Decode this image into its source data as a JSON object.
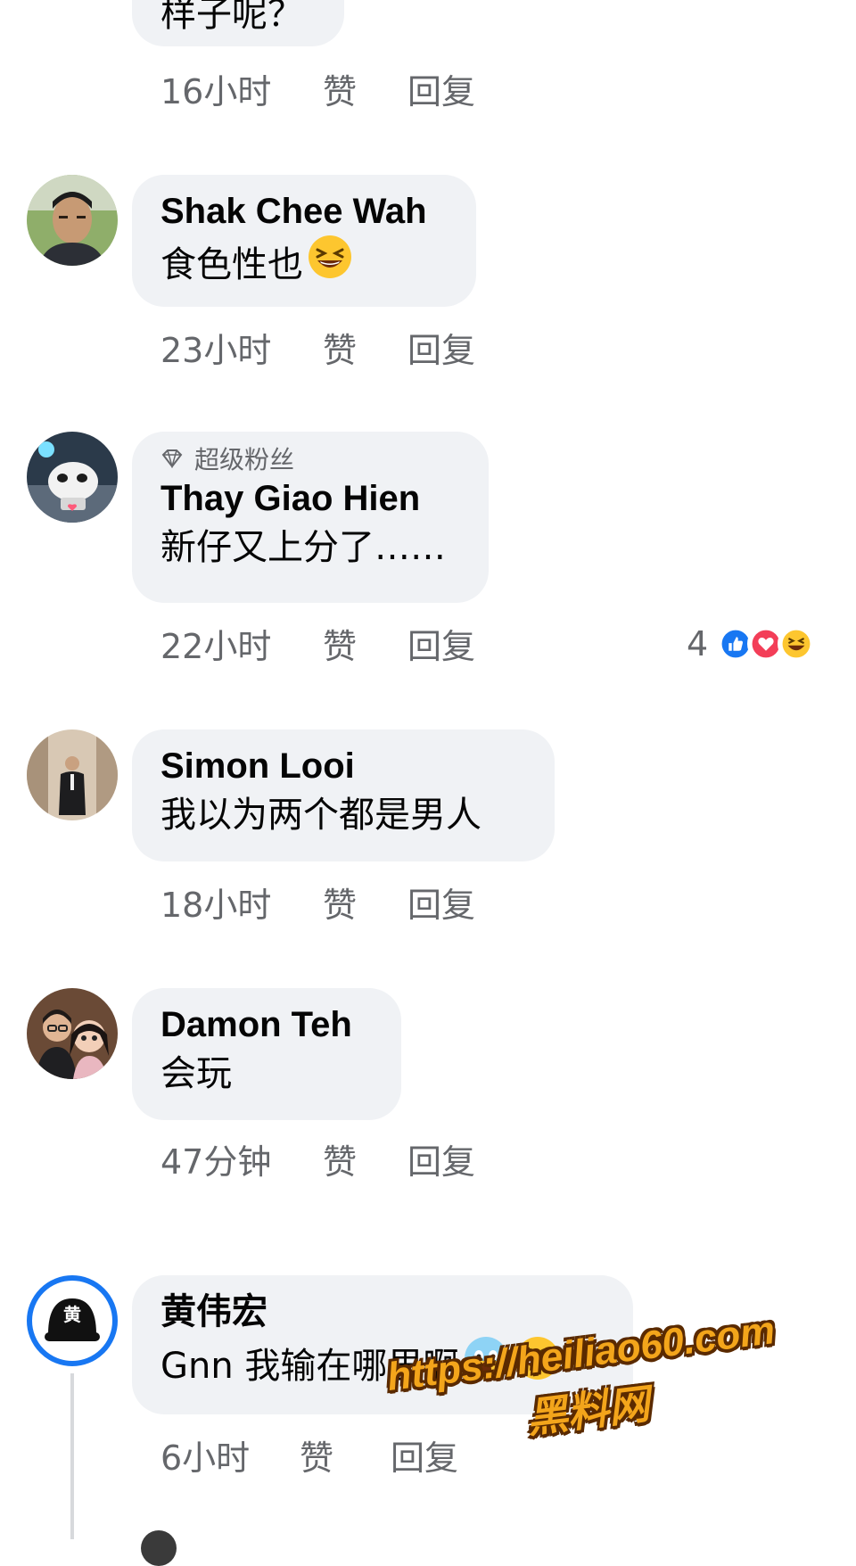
{
  "comments": [
    {
      "text": "样子呢？",
      "time": "16小时",
      "like_label": "赞",
      "reply_label": "回复"
    },
    {
      "author": "Shak Chee Wah",
      "text": "食色性也",
      "emoji": "laughing-emoji",
      "time": "23小时",
      "like_label": "赞",
      "reply_label": "回复"
    },
    {
      "badge": "超级粉丝",
      "author": "Thay Giao Hien",
      "text": "新仔又上分了……",
      "time": "22小时",
      "like_label": "赞",
      "reply_label": "回复",
      "reactions": {
        "count": "4",
        "icons": [
          "like-reaction-icon",
          "love-reaction-icon",
          "haha-reaction-icon"
        ]
      }
    },
    {
      "author": "Simon Looi",
      "text": "我以为两个都是男人",
      "time": "18小时",
      "like_label": "赞",
      "reply_label": "回复"
    },
    {
      "author": "Damon Teh",
      "text": "会玩",
      "time": "47分钟",
      "like_label": "赞",
      "reply_label": "回复"
    },
    {
      "author": "黄伟宏",
      "avatar_glyph": "黄",
      "text": "Gnn 我输在哪里啊",
      "emojis": [
        "screaming-emoji",
        "crying-laughing-emoji"
      ],
      "time": "6小时",
      "like_label": "赞",
      "reply_label": "回复"
    }
  ],
  "watermark": {
    "url": "https://heiliao60.com",
    "name": "黑料网"
  },
  "colors": {
    "bubble": "#f0f2f5",
    "meta_text": "#65676b",
    "like_blue": "#1877f2",
    "love_red": "#f33e58",
    "watermark": "#f3a51b"
  }
}
